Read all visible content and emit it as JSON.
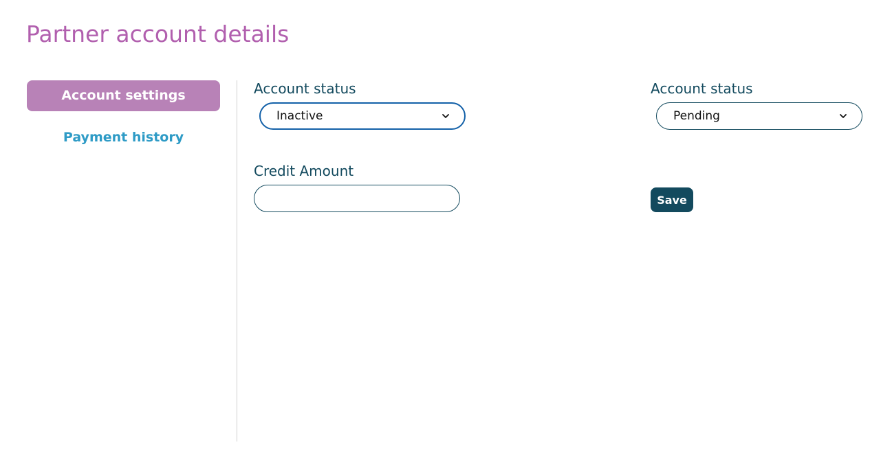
{
  "page": {
    "title": "Partner account details"
  },
  "sidebar": {
    "items": [
      {
        "label": "Account settings",
        "active": true
      },
      {
        "label": "Payment history",
        "active": false
      }
    ]
  },
  "form": {
    "account_status_left": {
      "label": "Account status",
      "value": "Inactive"
    },
    "account_status_right": {
      "label": "Account status",
      "value": "Pending"
    },
    "credit_amount": {
      "label": "Credit Amount",
      "value": "",
      "placeholder": ""
    },
    "save_label": "Save"
  },
  "colors": {
    "title": "#b15fae",
    "active_nav_bg": "#b882b7",
    "link": "#2e9bc6",
    "primary_dark": "#134a5e",
    "focus_border": "#1260a8"
  },
  "icons": {
    "select_arrow": "chevron-down-icon"
  }
}
